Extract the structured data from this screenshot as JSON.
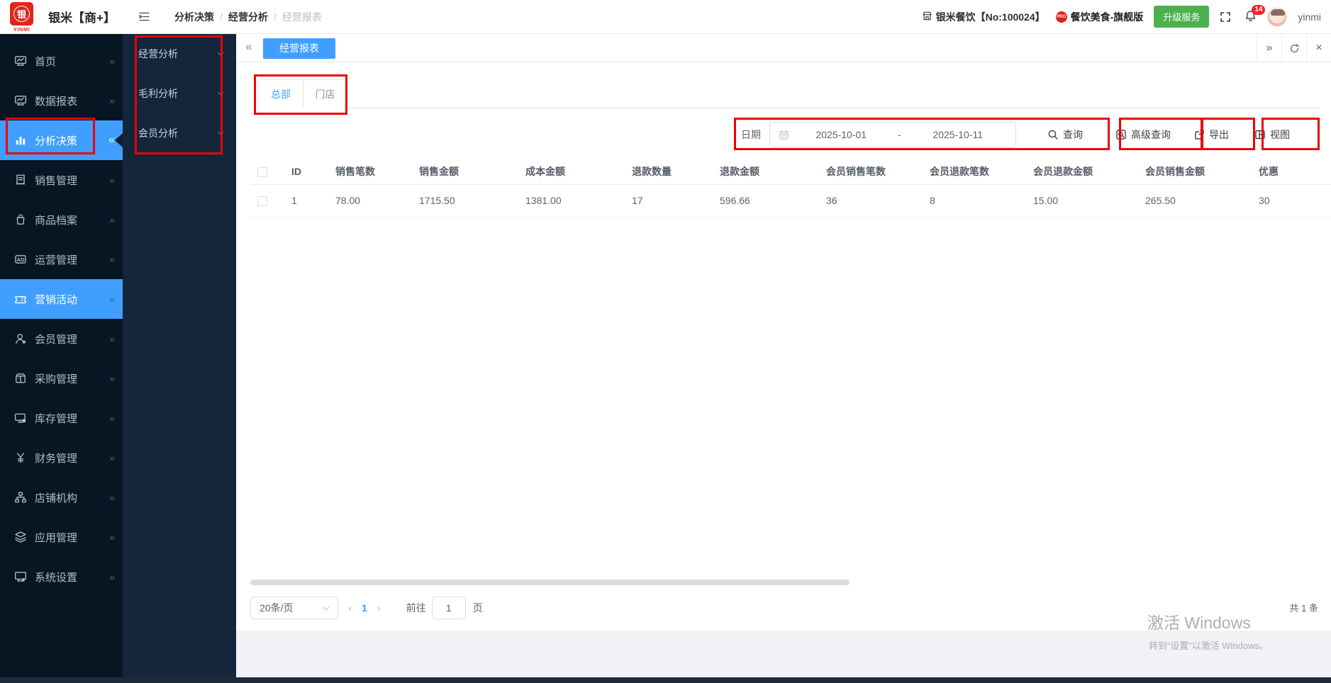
{
  "glyphs": {
    "collapse": "«",
    "expand": "»",
    "close": "×",
    "prev": "‹",
    "next": "›",
    "breadcrumb_sep": "/"
  },
  "colors": {
    "accent": "#409eff",
    "annotation_red": "#ec0202",
    "upgrade_green": "#4cb04f",
    "sidebar_bg": "#081523",
    "submenu_bg": "#13263c"
  },
  "header": {
    "logo_text": "银",
    "logo_sub": "YINMI",
    "app_title": "银米【商+】",
    "breadcrumb": [
      "分析决策",
      "经营分析",
      "经营报表"
    ],
    "store_label": "银米餐饮【No:100024】",
    "plan_badge": "PRO",
    "plan_label": "餐饮美食-旗舰版",
    "upgrade_button": "升级服务",
    "notification_count": "14",
    "username": "yinmi"
  },
  "sidebar": {
    "items": [
      {
        "id": "home",
        "label": "首页",
        "icon": "monitor-chart-icon",
        "state": "normal"
      },
      {
        "id": "data-report",
        "label": "数据报表",
        "icon": "report-chart-icon",
        "state": "normal"
      },
      {
        "id": "analysis-decision",
        "label": "分析决策",
        "icon": "bar-chart-icon",
        "state": "active"
      },
      {
        "id": "sales-mgmt",
        "label": "销售管理",
        "icon": "receipt-icon",
        "state": "normal"
      },
      {
        "id": "goods-archive",
        "label": "商品档案",
        "icon": "goods-bag-icon",
        "state": "normal"
      },
      {
        "id": "operation-mgmt",
        "label": "运营管理",
        "icon": "ad-icon",
        "state": "normal"
      },
      {
        "id": "marketing-activity",
        "label": "营销活动",
        "icon": "coupon-icon",
        "state": "highlight"
      },
      {
        "id": "member-mgmt",
        "label": "会员管理",
        "icon": "member-icon",
        "state": "normal"
      },
      {
        "id": "purchase-mgmt",
        "label": "采购管理",
        "icon": "purchase-box-icon",
        "state": "normal"
      },
      {
        "id": "inventory-mgmt",
        "label": "库存管理",
        "icon": "inventory-monitor-icon",
        "state": "normal"
      },
      {
        "id": "finance-mgmt",
        "label": "财务管理",
        "icon": "yen-icon",
        "state": "normal"
      },
      {
        "id": "store-org",
        "label": "店铺机构",
        "icon": "org-chart-icon",
        "state": "normal"
      },
      {
        "id": "app-mgmt",
        "label": "应用管理",
        "icon": "layers-icon",
        "state": "normal"
      },
      {
        "id": "system-settings",
        "label": "系统设置",
        "icon": "settings-monitor-icon",
        "state": "normal"
      }
    ]
  },
  "submenu": {
    "items": [
      {
        "id": "business-analysis",
        "label": "经营分析"
      },
      {
        "id": "gross-profit-analysis",
        "label": "毛利分析"
      },
      {
        "id": "member-analysis",
        "label": "会员分析"
      }
    ]
  },
  "content": {
    "page_tab": "经营报表",
    "tabs": [
      {
        "label": "总部",
        "active": true
      },
      {
        "label": "门店",
        "active": false
      }
    ],
    "filter": {
      "date_label": "日期",
      "date_start": "2025-10-01",
      "date_sep": "-",
      "date_end": "2025-10-11",
      "query": "查询",
      "advanced_query": "高级查询",
      "export": "导出",
      "view": "视图"
    },
    "table": {
      "columns": [
        "ID",
        "销售笔数",
        "销售金额",
        "成本金额",
        "退款数量",
        "退款金额",
        "会员销售笔数",
        "会员退款笔数",
        "会员退款金额",
        "会员销售金额",
        "优惠"
      ],
      "rows": [
        [
          "1",
          "78.00",
          "1715.50",
          "1381.00",
          "17",
          "596.66",
          "36",
          "8",
          "15.00",
          "265.50",
          "30"
        ]
      ]
    },
    "pagination": {
      "page_size": "20条/页",
      "current_page": "1",
      "goto_label": "前往",
      "goto_value": "1",
      "page_unit": "页",
      "total": "共 1 条"
    }
  },
  "watermark": {
    "line1": "激活 Windows",
    "line2": "转到“设置”以激活 Windows。"
  }
}
